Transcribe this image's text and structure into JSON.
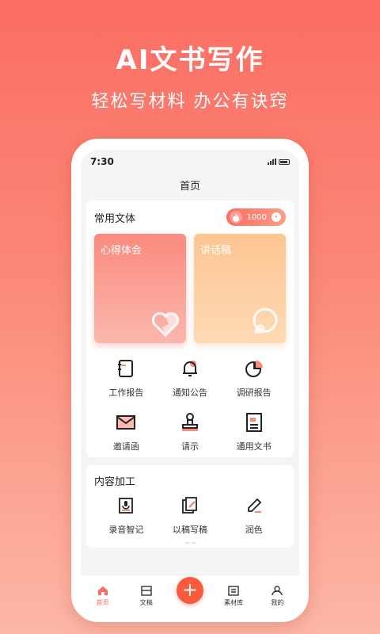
{
  "promo": {
    "title": "AI文书写作",
    "subtitle": "轻松写材料  办公有诀窍"
  },
  "status_bar": {
    "time": "7:30"
  },
  "nav": {
    "title": "首页"
  },
  "common_styles": {
    "title": "常用文体",
    "points": "1000",
    "feature_cards": [
      {
        "label": "心得体会",
        "icon": "heart-icon"
      },
      {
        "label": "讲话稿",
        "icon": "speech-bubble-icon"
      }
    ],
    "items": [
      {
        "label": "工作报告",
        "icon": "notebook-icon"
      },
      {
        "label": "通知公告",
        "icon": "bell-icon"
      },
      {
        "label": "调研报告",
        "icon": "pie-chart-icon"
      },
      {
        "label": "邀请函",
        "icon": "envelope-icon"
      },
      {
        "label": "请示",
        "icon": "stamp-icon"
      },
      {
        "label": "通用文书",
        "icon": "document-icon"
      }
    ]
  },
  "content_processing": {
    "title": "内容加工",
    "items": [
      {
        "label": "录音智记",
        "icon": "recorder-icon"
      },
      {
        "label": "以稿写稿",
        "icon": "copy-edit-icon"
      },
      {
        "label": "润色",
        "icon": "pen-icon"
      }
    ]
  },
  "tabbar": {
    "items": [
      {
        "label": "首页",
        "icon": "home-icon"
      },
      {
        "label": "文稿",
        "icon": "drafts-icon"
      },
      {
        "label": "+",
        "icon": "add-icon"
      },
      {
        "label": "素材库",
        "icon": "library-icon"
      },
      {
        "label": "我的",
        "icon": "profile-icon"
      }
    ]
  },
  "colors": {
    "accent": "#fb6d63",
    "orange": "#fdc592",
    "add_button": "#fa5a3c"
  }
}
